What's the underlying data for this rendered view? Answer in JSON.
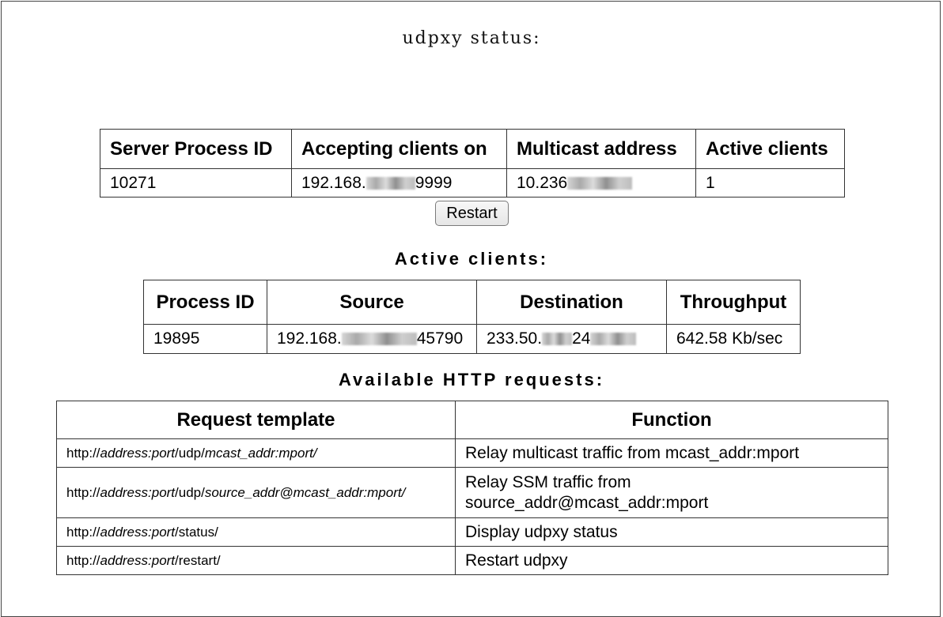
{
  "page": {
    "title": "udpxy status:"
  },
  "server_table": {
    "headers": [
      "Server Process ID",
      "Accepting clients on",
      "Multicast address",
      "Active clients"
    ],
    "row": {
      "pid": "10271",
      "accepting_prefix": "192.168.",
      "accepting_suffix": "9999",
      "multicast_prefix": "10.236",
      "active_clients": "1"
    }
  },
  "restart_button": {
    "label": "Restart"
  },
  "clients_section": {
    "heading": "Active clients:",
    "headers": [
      "Process ID",
      "Source",
      "Destination",
      "Throughput"
    ],
    "row": {
      "pid": "19895",
      "source_prefix": "192.168.",
      "source_suffix": "45790",
      "dest_prefix": "233.50.",
      "dest_mid": "24",
      "throughput": "642.58 Kb/sec"
    }
  },
  "requests_section": {
    "heading": "Available HTTP requests:",
    "headers": [
      "Request template",
      "Function"
    ],
    "rows": [
      {
        "t0": "http://",
        "t1": "address:port",
        "t2": "/udp/",
        "t3": "mcast_addr:mport/",
        "fn": "Relay multicast traffic from mcast_addr:mport"
      },
      {
        "t0": "http://",
        "t1": "address:port",
        "t2": "/udp/",
        "t3": "source_addr@mcast_addr:mport/",
        "fn": "Relay SSM traffic from source_addr@mcast_addr:mport"
      },
      {
        "t0": "http://",
        "t1": "address:port",
        "t2": "/status/",
        "fn": "Display udpxy status"
      },
      {
        "t0": "http://",
        "t1": "address:port",
        "t2": "/restart/",
        "fn": "Restart udpxy"
      }
    ]
  }
}
